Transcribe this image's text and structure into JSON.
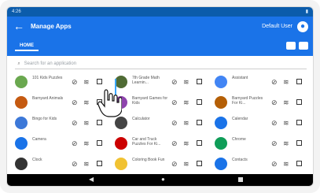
{
  "status": {
    "time": "4:26",
    "battery": "▮"
  },
  "app": {
    "title": "Manage Apps",
    "user_label": "Default User"
  },
  "tabs": {
    "home": "HOME"
  },
  "search": {
    "placeholder": "Search for an application"
  },
  "apps": [
    {
      "col": 0,
      "row": 0,
      "name": "101 Kids Puzzles",
      "color": "#6aa84f"
    },
    {
      "col": 1,
      "row": 0,
      "name": "7th Grade Math Learnin...",
      "color": "#4f6b34"
    },
    {
      "col": 2,
      "row": 0,
      "name": "Assistant",
      "color": "#4285f4"
    },
    {
      "col": 0,
      "row": 1,
      "name": "Barnyard Animals",
      "color": "#c55a11"
    },
    {
      "col": 1,
      "row": 1,
      "name": "Barnyard Games for Kids",
      "color": "#8e44ad"
    },
    {
      "col": 2,
      "row": 1,
      "name": "Barnyard Puzzles For Ki...",
      "color": "#b45f06"
    },
    {
      "col": 0,
      "row": 2,
      "name": "Bingo for Kids",
      "color": "#3c78d8"
    },
    {
      "col": 1,
      "row": 2,
      "name": "Calculator",
      "color": "#444444"
    },
    {
      "col": 2,
      "row": 2,
      "name": "Calendar",
      "color": "#1a73e8"
    },
    {
      "col": 0,
      "row": 3,
      "name": "Camera",
      "color": "#1a73e8"
    },
    {
      "col": 1,
      "row": 3,
      "name": "Car and Truck Puzzles For Ki...",
      "color": "#cc0000"
    },
    {
      "col": 2,
      "row": 3,
      "name": "Chrome",
      "color": "#0f9d58"
    },
    {
      "col": 0,
      "row": 4,
      "name": "Clock",
      "color": "#333333"
    },
    {
      "col": 1,
      "row": 4,
      "name": "Coloring Book Fun",
      "color": "#f1c232"
    },
    {
      "col": 2,
      "row": 4,
      "name": "Contacts",
      "color": "#1a73e8"
    }
  ]
}
